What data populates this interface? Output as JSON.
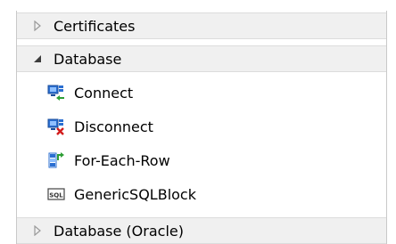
{
  "categories": [
    {
      "label": "Certificates",
      "expanded": false
    },
    {
      "label": "Database",
      "expanded": true
    },
    {
      "label": "Database (Oracle)",
      "expanded": false
    }
  ],
  "database_items": [
    {
      "label": "Connect",
      "icon": "database-connect-icon"
    },
    {
      "label": "Disconnect",
      "icon": "database-disconnect-icon"
    },
    {
      "label": "For-Each-Row",
      "icon": "for-each-row-icon"
    },
    {
      "label": "GenericSQLBlock",
      "icon": "sql-block-icon"
    }
  ],
  "colors": {
    "category_bg": "#f0f0f0",
    "icon_blue": "#2b6fd1",
    "icon_green": "#2e9e35",
    "icon_red": "#d21c1c"
  }
}
